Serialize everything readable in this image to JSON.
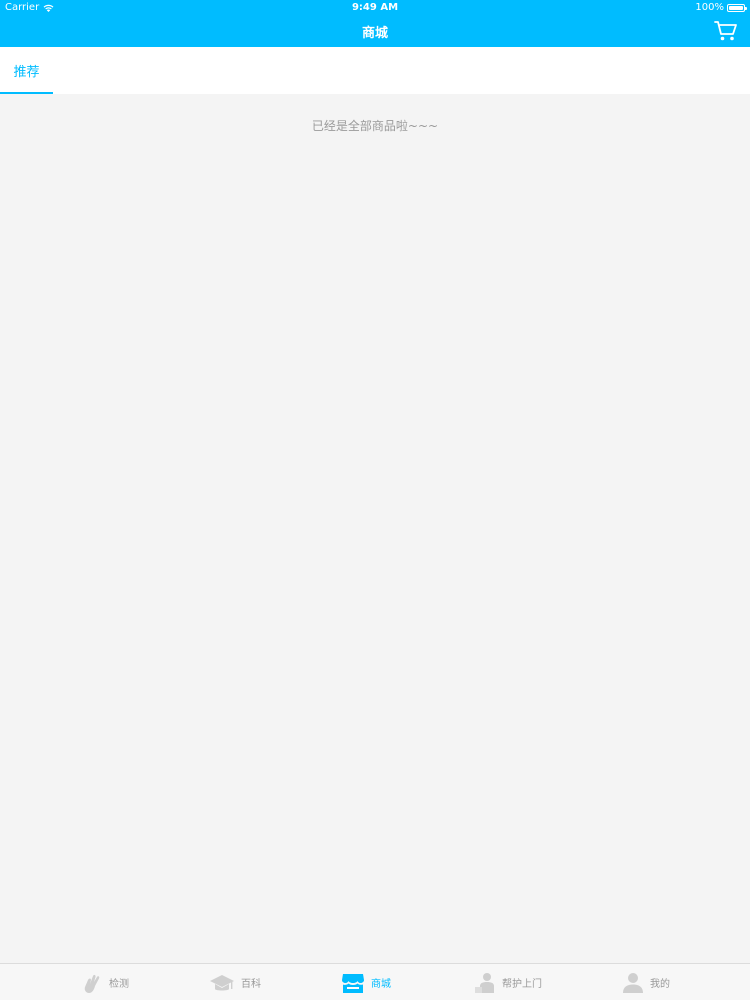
{
  "status_bar": {
    "carrier": "Carrier",
    "time": "9:49 AM",
    "battery": "100%"
  },
  "nav": {
    "title": "商城",
    "cart_icon": "cart-icon"
  },
  "tabs": [
    {
      "label": "推荐",
      "active": true
    }
  ],
  "content": {
    "end_message": "已经是全部商品啦~~~"
  },
  "tab_bar": {
    "items": [
      {
        "label": "检测",
        "icon": "detect-icon",
        "active": false
      },
      {
        "label": "百科",
        "icon": "graduation-cap-icon",
        "active": false
      },
      {
        "label": "商城",
        "icon": "store-icon",
        "active": true
      },
      {
        "label": "帮护上门",
        "icon": "home-care-icon",
        "active": false
      },
      {
        "label": "我的",
        "icon": "user-icon",
        "active": false
      }
    ]
  },
  "colors": {
    "primary": "#00bcff",
    "background": "#f4f4f4",
    "inactive": "#999999"
  }
}
